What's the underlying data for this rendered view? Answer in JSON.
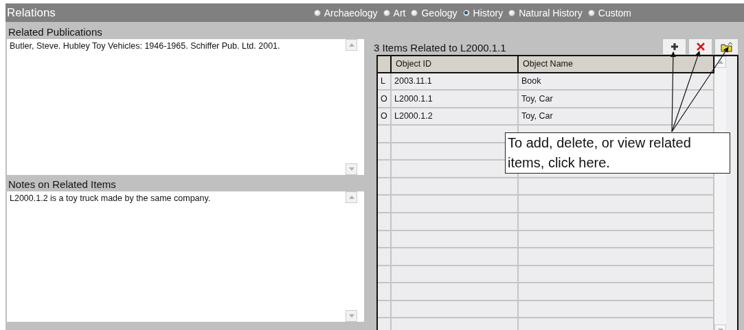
{
  "header": {
    "title": "Relations",
    "disciplines": [
      {
        "label": "Archaeology",
        "selected": false
      },
      {
        "label": "Art",
        "selected": false
      },
      {
        "label": "Geology",
        "selected": false
      },
      {
        "label": "History",
        "selected": true
      },
      {
        "label": "Natural History",
        "selected": false
      },
      {
        "label": "Custom",
        "selected": false
      }
    ]
  },
  "publications": {
    "label": "Related Publications",
    "value": "Butler, Steve. Hubley Toy Vehicles: 1946-1965. Schiffer Pub. Ltd. 2001."
  },
  "notes": {
    "label": "Notes on Related Items",
    "value": "L2000.1.2 is a toy truck made by the same company."
  },
  "related": {
    "title": "3 Items Related to L2000.1.1",
    "columns": [
      "Object ID",
      "Object Name"
    ],
    "rows": [
      {
        "type": "L",
        "id": "2003.11.1",
        "name": "Book"
      },
      {
        "type": "O",
        "id": "L2000.1.1",
        "name": "Toy, Car"
      },
      {
        "type": "O",
        "id": "L2000.1.2",
        "name": "Toy, Car"
      }
    ]
  },
  "callout": {
    "text": "To add, delete, or view related items, click here."
  }
}
